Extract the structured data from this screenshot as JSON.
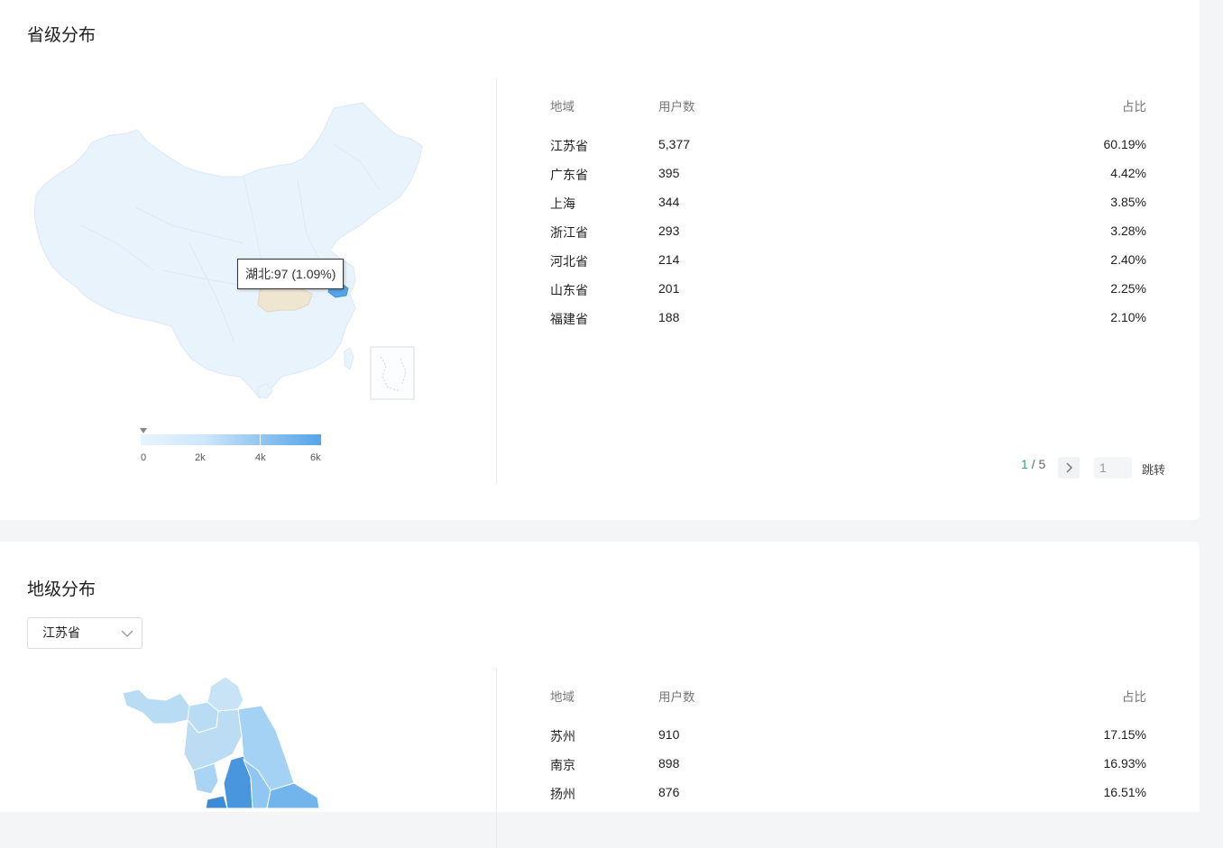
{
  "province_section": {
    "title": "省级分布",
    "tooltip": "湖北:97 (1.09%)",
    "legend_ticks": [
      "0",
      "2k",
      "4k",
      "6k"
    ],
    "table": {
      "headers": {
        "region": "地域",
        "users": "用户数",
        "percent": "占比"
      },
      "rows": [
        {
          "region": "江苏省",
          "users": "5,377",
          "percent": "60.19%"
        },
        {
          "region": "广东省",
          "users": "395",
          "percent": "4.42%"
        },
        {
          "region": "上海",
          "users": "344",
          "percent": "3.85%"
        },
        {
          "region": "浙江省",
          "users": "293",
          "percent": "3.28%"
        },
        {
          "region": "河北省",
          "users": "214",
          "percent": "2.40%"
        },
        {
          "region": "山东省",
          "users": "201",
          "percent": "2.25%"
        },
        {
          "region": "福建省",
          "users": "188",
          "percent": "2.10%"
        }
      ]
    },
    "pagination": {
      "current": "1",
      "separator": "/",
      "total": "5",
      "next_icon": "chevron-right-icon",
      "input_value": "1",
      "jump_label": "跳转"
    }
  },
  "city_section": {
    "title": "地级分布",
    "select_value": "江苏省",
    "table": {
      "headers": {
        "region": "地域",
        "users": "用户数",
        "percent": "占比"
      },
      "rows": [
        {
          "region": "苏州",
          "users": "910",
          "percent": "17.15%"
        },
        {
          "region": "南京",
          "users": "898",
          "percent": "16.93%"
        },
        {
          "region": "扬州",
          "users": "876",
          "percent": "16.51%"
        }
      ]
    }
  },
  "colors": {
    "map_base": "#e9f3fc",
    "map_highlight": "#56a4e8",
    "hover_province": "#efe6d2",
    "accent_green": "#2faa6e"
  }
}
